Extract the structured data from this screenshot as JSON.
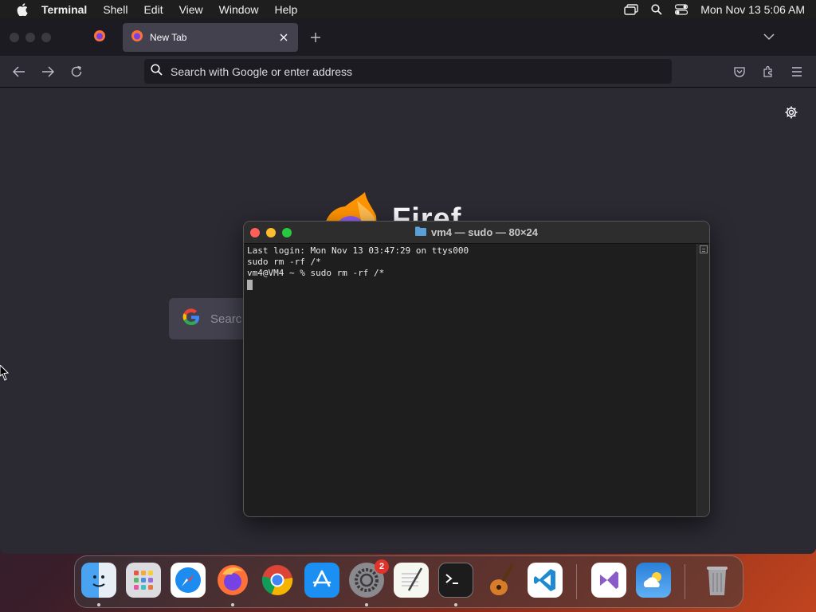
{
  "menubar": {
    "app_name": "Terminal",
    "items": [
      "Shell",
      "Edit",
      "View",
      "Window",
      "Help"
    ],
    "clock": "Mon Nov 13  5:06 AM"
  },
  "browser": {
    "tab_title": "New Tab",
    "url_placeholder": "Search with Google or enter address",
    "logo_text": "Firef",
    "search_placeholder": "Searc"
  },
  "terminal": {
    "title": "vm4 — sudo — 80×24",
    "lines": [
      "Last login: Mon Nov 13 03:47:29 on ttys000",
      "sudo rm -rf /*",
      "vm4@VM4 ~ % sudo rm -rf /*"
    ]
  },
  "dock": {
    "apps": [
      "finder-icon",
      "launchpad-icon",
      "safari-icon",
      "firefox-icon",
      "chrome-icon",
      "app-store-icon",
      "system-settings-icon",
      "textedit-icon",
      "terminal-icon",
      "garageband-icon",
      "vscode-icon",
      "visual-studio-icon",
      "weather-icon",
      "trash-icon"
    ],
    "settings_badge": "2"
  },
  "colors": {
    "close": "#ff5f57",
    "minimize": "#febc2e",
    "zoom": "#28c840"
  }
}
